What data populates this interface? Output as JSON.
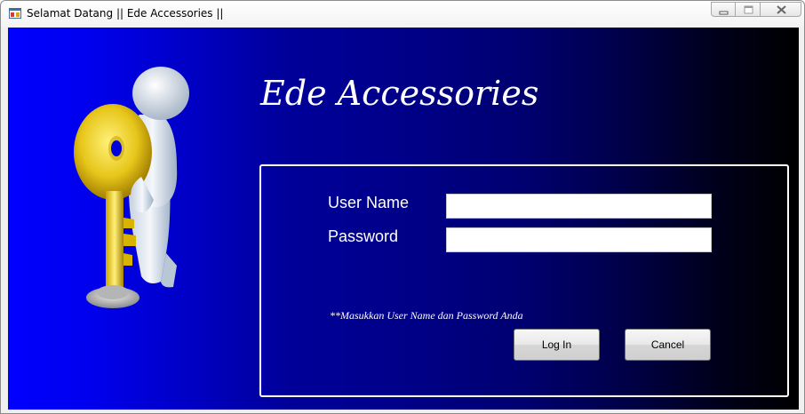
{
  "window": {
    "title": "Selamat Datang || Ede Accessories ||",
    "controls": {
      "minimize_icon": "minimize-icon",
      "maximize_icon": "maximize-icon",
      "close_icon": "close-icon"
    }
  },
  "main": {
    "heading": "Ede Accessories",
    "illustration_icon": "person-holding-key-illustration",
    "login": {
      "username_label": "User Name",
      "username_value": "",
      "password_label": "Password",
      "password_value": "",
      "hint": "**Masukkan User Name dan Password Anda",
      "login_button": "Log In",
      "cancel_button": "Cancel"
    }
  },
  "colors": {
    "gradient_start": "#0000ff",
    "gradient_end": "#000000",
    "text": "#ffffff"
  }
}
